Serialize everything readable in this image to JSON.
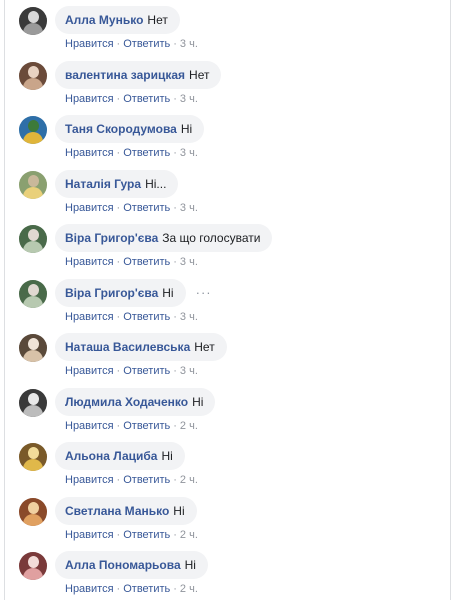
{
  "labels": {
    "like": "Нравится",
    "reply": "Ответить",
    "separator": "·"
  },
  "comments": [
    {
      "author": "Алла Мунько",
      "text": "Нет",
      "time": "3 ч.",
      "avatar_colors": [
        "#3a3a3a",
        "#9a9a9a",
        "#d8d8d8"
      ]
    },
    {
      "author": "валентина зарицкая",
      "text": "Нет",
      "time": "3 ч.",
      "avatar_colors": [
        "#6b4b3a",
        "#c9a58a",
        "#e8d2c2"
      ]
    },
    {
      "author": "Таня Скородумова",
      "text": "Ні",
      "time": "3 ч.",
      "avatar_colors": [
        "#2e6fa8",
        "#e0b53a",
        "#3d7a3a"
      ]
    },
    {
      "author": "Наталія Гура",
      "text": "Ні...",
      "time": "3 ч.",
      "avatar_colors": [
        "#8aa070",
        "#e9d07a",
        "#c9b89a"
      ]
    },
    {
      "author": "Віра Григор'єва",
      "text": "За що голосувати",
      "time": "3 ч.",
      "avatar_colors": [
        "#4a6a4a",
        "#b7c9b0",
        "#e0d8d0"
      ]
    },
    {
      "author": "Віра Григор'єва",
      "text": "Ні",
      "time": "3 ч.",
      "avatar_colors": [
        "#4a6a4a",
        "#b7c9b0",
        "#e0d8d0"
      ],
      "more": "···"
    },
    {
      "author": "Наташа Василевська",
      "text": "Нет",
      "time": "3 ч.",
      "avatar_colors": [
        "#5a4a3a",
        "#d8c2a8",
        "#f0e4d8"
      ]
    },
    {
      "author": "Людмила Ходаченко",
      "text": "Ні",
      "time": "2 ч.",
      "avatar_colors": [
        "#3a3a3a",
        "#bcbcbc",
        "#e8e8e8"
      ]
    },
    {
      "author": "Альона Лациба",
      "text": "Ні",
      "time": "2 ч.",
      "avatar_colors": [
        "#7a5a2a",
        "#e0b84a",
        "#f2dc9a"
      ]
    },
    {
      "author": "Светлана Манько",
      "text": "Ні",
      "time": "2 ч.",
      "avatar_colors": [
        "#8a4a2a",
        "#e0a060",
        "#f0d0a0"
      ]
    },
    {
      "author": "Алла Пономарьова",
      "text": "Ні",
      "time": "2 ч.",
      "avatar_colors": [
        "#7a3a3a",
        "#e0a0a0",
        "#f2dcd8"
      ]
    }
  ]
}
